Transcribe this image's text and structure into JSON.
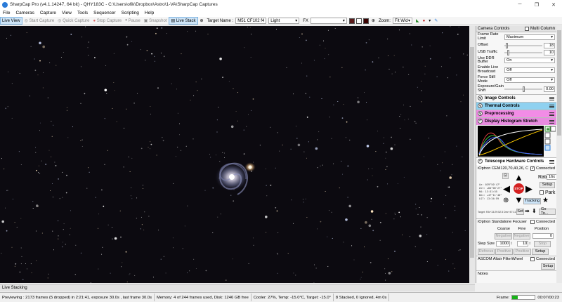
{
  "window": {
    "title": "SharpCap Pro (v4.1.14247, 64 bit) - QHY183C - C:\\Users\\ofik\\Dropbox\\Astro\\1-VA\\SharpCap Captures",
    "controls": [
      "─",
      "❐",
      "✕"
    ]
  },
  "menu": [
    "File",
    "Cameras",
    "Capture",
    "View",
    "Tools",
    "Sequencer",
    "Scripting",
    "Help"
  ],
  "toolbar": {
    "live_view": "Live View",
    "start_capture": "Start Capture",
    "quick_capture": "Quick Capture",
    "stop_capture": "Stop Capture",
    "pause": "Pause",
    "snapshot": "Snapshot",
    "live_stack": "Live Stack",
    "target_name_label": "Target Name :",
    "target_name_value": "M51 CF102 f4",
    "frame_type": "Light",
    "fx_label": "FX",
    "zoom_label": "Zoom:",
    "zoom_value": "Fit Wid"
  },
  "panel": {
    "header": "Camera Controls",
    "multi_column": "Multi Column",
    "rows": [
      {
        "label": "Frame Rate Limit",
        "value": "Maximum"
      },
      {
        "label": "Offset",
        "value": "18"
      },
      {
        "label": "USB Traffic",
        "value": "10"
      },
      {
        "label": "Use DDR Buffer",
        "value": "On"
      },
      {
        "label": "Enable Live Broadcast",
        "value": "Off"
      },
      {
        "label": "Force Still Mode",
        "value": "Off"
      },
      {
        "label": "Exposure/Gain Shift",
        "value": "0.00"
      }
    ],
    "sections": {
      "image_controls": "Image Controls",
      "thermal_controls": "Thermal Controls",
      "preprocessing": "Preprocessing",
      "histogram": "Display Histogram Stretch",
      "telescope": "Telescope Hardware Controls"
    },
    "telescope": {
      "mount": "iOptron CEM120,70,40,26, C",
      "connected": "Connected",
      "rate_label": "Rate:",
      "rate_value": "16x",
      "setup": "Setup",
      "park": "Park",
      "stop": "STOP",
      "tracking": "Tracking",
      "set": "Set",
      "goto": "Go To...",
      "coords": [
        "Az:   039°50'47\"",
        "Alt:  +84°06'27\"",
        "RA:   13:31:55",
        "Dec:  +47°11'40\"",
        "LST:  13:34:59"
      ],
      "target_line": "Target: RA+13:29:52.5 Dec+47:11:43.1"
    },
    "focuser": {
      "name": "iOptron Standalone Focuser",
      "connected": "Connected",
      "coarse": "Coarse",
      "fine": "Fine",
      "position": "Position",
      "negative": "Negative",
      "position_value": "0",
      "step_size_label": "Step Size",
      "step_coarse": "1000",
      "step_fine": "10",
      "stop": "Stop",
      "refocus": "Refocus",
      "positive": "Positive",
      "setup": "Setup"
    },
    "filterwheel": {
      "name": "ASCOM Altair FilterWheel",
      "connected": "Connected",
      "setup": "Setup"
    },
    "notes": "Notes"
  },
  "live_strip": "Live Stacking",
  "status": {
    "preview": "Previewing : 2173 frames (5 dropped) in 2:21:41, exposure 30.0s , last frame 30.0s",
    "memory": "Memory: 4 of 244 frames used, Disk: 1246 GB free",
    "cooler": "Cooler: 27%, Temp: -15.0°C, Target: -15.0°",
    "stack": "8 Stacked, 0 Ignored, 4m 0s",
    "frame_label": "Frame:",
    "frame_progress": 0.23,
    "frame_time": "00:07/00:23"
  },
  "colors": {
    "thermal": "#8fd1f0",
    "preprocessing": "#f28ce6",
    "histogram": "#e88be0",
    "accent": "#2a7bd8"
  }
}
